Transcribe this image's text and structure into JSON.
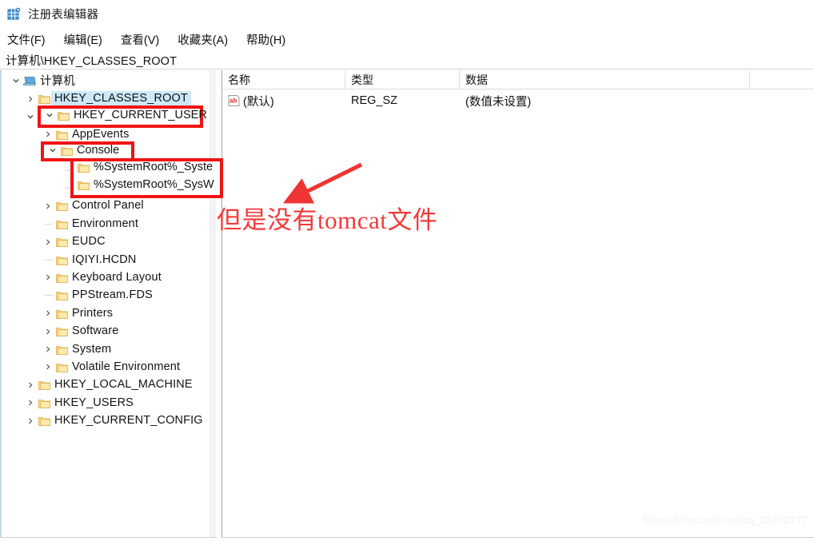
{
  "window": {
    "title": "注册表编辑器",
    "icon": "registry-editor-icon"
  },
  "menubar": {
    "items": [
      {
        "label": "文件(F)",
        "name": "menu-file"
      },
      {
        "label": "编辑(E)",
        "name": "menu-edit"
      },
      {
        "label": "查看(V)",
        "name": "menu-view"
      },
      {
        "label": "收藏夹(A)",
        "name": "menu-favorites"
      },
      {
        "label": "帮助(H)",
        "name": "menu-help"
      }
    ]
  },
  "address": {
    "path": "计算机\\HKEY_CLASSES_ROOT"
  },
  "tree": {
    "items": [
      {
        "label": "计算机",
        "depth": 0,
        "icon": "computer-icon",
        "twisty": "expanded",
        "selected": false
      },
      {
        "label": "HKEY_CLASSES_ROOT",
        "depth": 1,
        "icon": "folder-icon",
        "twisty": "collapsed",
        "selected": true
      },
      {
        "label": "HKEY_CURRENT_USER",
        "depth": 1,
        "icon": "folder-icon",
        "twisty": "expanded",
        "selected": false
      },
      {
        "label": "AppEvents",
        "depth": 2,
        "icon": "folder-icon",
        "twisty": "collapsed",
        "selected": false
      },
      {
        "label": "Console",
        "depth": 2,
        "icon": "folder-icon",
        "twisty": "expanded",
        "selected": false
      },
      {
        "label": "%SystemRoot%_Syste",
        "depth": 3,
        "icon": "folder-icon",
        "twisty": "leaf",
        "selected": false
      },
      {
        "label": "%SystemRoot%_SysW",
        "depth": 3,
        "icon": "folder-icon",
        "twisty": "leaf",
        "selected": false
      },
      {
        "label": "Control Panel",
        "depth": 2,
        "icon": "folder-icon",
        "twisty": "collapsed",
        "selected": false
      },
      {
        "label": "Environment",
        "depth": 2,
        "icon": "folder-icon",
        "twisty": "leaf",
        "selected": false
      },
      {
        "label": "EUDC",
        "depth": 2,
        "icon": "folder-icon",
        "twisty": "collapsed",
        "selected": false
      },
      {
        "label": "IQIYI.HCDN",
        "depth": 2,
        "icon": "folder-icon",
        "twisty": "leaf",
        "selected": false
      },
      {
        "label": "Keyboard Layout",
        "depth": 2,
        "icon": "folder-icon",
        "twisty": "collapsed",
        "selected": false
      },
      {
        "label": "PPStream.FDS",
        "depth": 2,
        "icon": "folder-icon",
        "twisty": "leaf",
        "selected": false
      },
      {
        "label": "Printers",
        "depth": 2,
        "icon": "folder-icon",
        "twisty": "collapsed",
        "selected": false
      },
      {
        "label": "Software",
        "depth": 2,
        "icon": "folder-icon",
        "twisty": "collapsed",
        "selected": false
      },
      {
        "label": "System",
        "depth": 2,
        "icon": "folder-icon",
        "twisty": "collapsed",
        "selected": false
      },
      {
        "label": "Volatile Environment",
        "depth": 2,
        "icon": "folder-icon",
        "twisty": "collapsed",
        "selected": false
      },
      {
        "label": "HKEY_LOCAL_MACHINE",
        "depth": 1,
        "icon": "folder-icon",
        "twisty": "collapsed",
        "selected": false
      },
      {
        "label": "HKEY_USERS",
        "depth": 1,
        "icon": "folder-icon",
        "twisty": "collapsed",
        "selected": false
      },
      {
        "label": "HKEY_CURRENT_CONFIG",
        "depth": 1,
        "icon": "folder-icon",
        "twisty": "collapsed",
        "selected": false
      }
    ]
  },
  "values": {
    "columns": [
      {
        "label": "名称",
        "name": "column-name"
      },
      {
        "label": "类型",
        "name": "column-type"
      },
      {
        "label": "数据",
        "name": "column-data"
      }
    ],
    "rows": [
      {
        "name": "(默认)",
        "type": "REG_SZ",
        "data": "(数值未设置)",
        "icon": "string-value-icon"
      }
    ]
  },
  "annotations": {
    "text": "但是没有tomcat文件",
    "color": "#f43a3a",
    "box_color": "#f01414",
    "boxes": [
      {
        "name": "highlight-box-hkey-current-user"
      },
      {
        "name": "highlight-box-console"
      },
      {
        "name": "highlight-box-systemroot-keys"
      }
    ]
  },
  "watermark": {
    "text": "https://blog.csdn.net/qq_32492777"
  }
}
